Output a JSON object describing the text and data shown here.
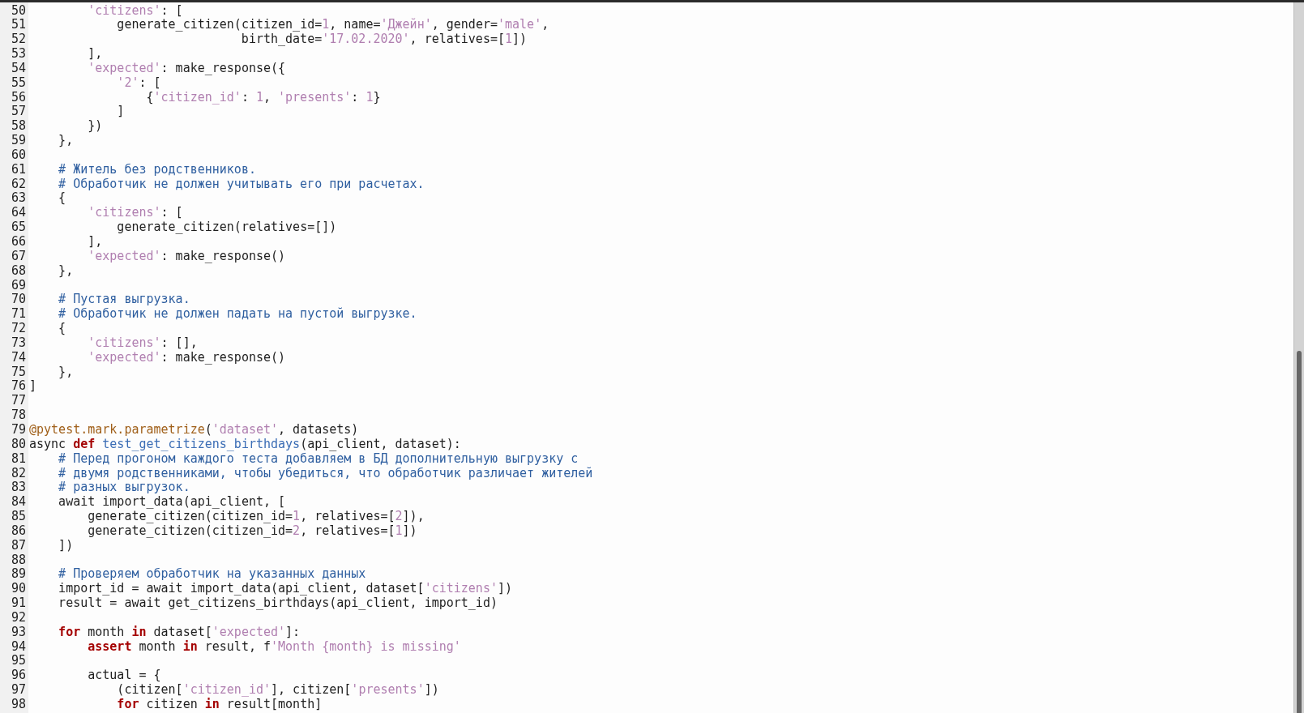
{
  "editor": {
    "lines": [
      {
        "number": "50",
        "tokens": [
          {
            "kind": "string",
            "text": "        'citizens'"
          },
          {
            "kind": "plain",
            "text": ": ["
          }
        ]
      },
      {
        "number": "51",
        "tokens": [
          {
            "kind": "plain",
            "text": "            generate_citizen(citizen_id="
          },
          {
            "kind": "number",
            "text": "1"
          },
          {
            "kind": "plain",
            "text": ", name="
          },
          {
            "kind": "string",
            "text": "'Джейн'"
          },
          {
            "kind": "plain",
            "text": ", gender="
          },
          {
            "kind": "string",
            "text": "'male'"
          },
          {
            "kind": "plain",
            "text": ","
          }
        ]
      },
      {
        "number": "52",
        "tokens": [
          {
            "kind": "plain",
            "text": "                             birth_date="
          },
          {
            "kind": "string",
            "text": "'17.02.2020'"
          },
          {
            "kind": "plain",
            "text": ", relatives=["
          },
          {
            "kind": "number",
            "text": "1"
          },
          {
            "kind": "plain",
            "text": "])"
          }
        ]
      },
      {
        "number": "53",
        "tokens": [
          {
            "kind": "plain",
            "text": "        ],"
          }
        ]
      },
      {
        "number": "54",
        "tokens": [
          {
            "kind": "string",
            "text": "        'expected'"
          },
          {
            "kind": "plain",
            "text": ": make_response({"
          }
        ]
      },
      {
        "number": "55",
        "tokens": [
          {
            "kind": "string",
            "text": "            '2'"
          },
          {
            "kind": "plain",
            "text": ": ["
          }
        ]
      },
      {
        "number": "56",
        "tokens": [
          {
            "kind": "plain",
            "text": "                {"
          },
          {
            "kind": "string",
            "text": "'citizen_id'"
          },
          {
            "kind": "plain",
            "text": ": "
          },
          {
            "kind": "number",
            "text": "1"
          },
          {
            "kind": "plain",
            "text": ", "
          },
          {
            "kind": "string",
            "text": "'presents'"
          },
          {
            "kind": "plain",
            "text": ": "
          },
          {
            "kind": "number",
            "text": "1"
          },
          {
            "kind": "plain",
            "text": "}"
          }
        ]
      },
      {
        "number": "57",
        "tokens": [
          {
            "kind": "plain",
            "text": "            ]"
          }
        ]
      },
      {
        "number": "58",
        "tokens": [
          {
            "kind": "plain",
            "text": "        })"
          }
        ]
      },
      {
        "number": "59",
        "tokens": [
          {
            "kind": "plain",
            "text": "    },"
          }
        ]
      },
      {
        "number": "60"
      },
      {
        "number": "61",
        "tokens": [
          {
            "kind": "comment",
            "text": "    # Житель без родственников."
          }
        ]
      },
      {
        "number": "62",
        "tokens": [
          {
            "kind": "comment",
            "text": "    # Обработчик не должен учитывать его при расчетах."
          }
        ]
      },
      {
        "number": "63",
        "tokens": [
          {
            "kind": "plain",
            "text": "    {"
          }
        ]
      },
      {
        "number": "64",
        "tokens": [
          {
            "kind": "string",
            "text": "        'citizens'"
          },
          {
            "kind": "plain",
            "text": ": ["
          }
        ]
      },
      {
        "number": "65",
        "tokens": [
          {
            "kind": "plain",
            "text": "            generate_citizen(relatives=[])"
          }
        ]
      },
      {
        "number": "66",
        "tokens": [
          {
            "kind": "plain",
            "text": "        ],"
          }
        ]
      },
      {
        "number": "67",
        "tokens": [
          {
            "kind": "string",
            "text": "        'expected'"
          },
          {
            "kind": "plain",
            "text": ": make_response()"
          }
        ]
      },
      {
        "number": "68",
        "tokens": [
          {
            "kind": "plain",
            "text": "    },"
          }
        ]
      },
      {
        "number": "69"
      },
      {
        "number": "70",
        "tokens": [
          {
            "kind": "comment",
            "text": "    # Пустая выгрузка."
          }
        ]
      },
      {
        "number": "71",
        "tokens": [
          {
            "kind": "comment",
            "text": "    # Обработчик не должен падать на пустой выгрузке."
          }
        ]
      },
      {
        "number": "72",
        "tokens": [
          {
            "kind": "plain",
            "text": "    {"
          }
        ]
      },
      {
        "number": "73",
        "tokens": [
          {
            "kind": "string",
            "text": "        'citizens'"
          },
          {
            "kind": "plain",
            "text": ": [],"
          }
        ]
      },
      {
        "number": "74",
        "tokens": [
          {
            "kind": "string",
            "text": "        'expected'"
          },
          {
            "kind": "plain",
            "text": ": make_response()"
          }
        ]
      },
      {
        "number": "75",
        "tokens": [
          {
            "kind": "plain",
            "text": "    },"
          }
        ]
      },
      {
        "number": "76",
        "tokens": [
          {
            "kind": "plain",
            "text": "]"
          }
        ]
      },
      {
        "number": "77"
      },
      {
        "number": "78"
      },
      {
        "number": "79",
        "tokens": [
          {
            "kind": "decorator",
            "text": "@pytest.mark.parametrize"
          },
          {
            "kind": "plain",
            "text": "("
          },
          {
            "kind": "string",
            "text": "'dataset'"
          },
          {
            "kind": "plain",
            "text": ", datasets)"
          }
        ]
      },
      {
        "number": "80",
        "tokens": [
          {
            "kind": "plain",
            "text": "async "
          },
          {
            "kind": "keyword",
            "text": "def"
          },
          {
            "kind": "function",
            "text": " test_get_citizens_birthdays"
          },
          {
            "kind": "plain",
            "text": "(api_client, dataset):"
          }
        ]
      },
      {
        "number": "81",
        "tokens": [
          {
            "kind": "comment",
            "text": "    # Перед прогоном каждого теста добавляем в БД дополнительную выгрузку с"
          }
        ]
      },
      {
        "number": "82",
        "tokens": [
          {
            "kind": "comment",
            "text": "    # двумя родственниками, чтобы убедиться, что обработчик различает жителей"
          }
        ]
      },
      {
        "number": "83",
        "tokens": [
          {
            "kind": "comment",
            "text": "    # разных выгрузок."
          }
        ]
      },
      {
        "number": "84",
        "tokens": [
          {
            "kind": "plain",
            "text": "    await import_data(api_client, ["
          }
        ]
      },
      {
        "number": "85",
        "tokens": [
          {
            "kind": "plain",
            "text": "        generate_citizen(citizen_id="
          },
          {
            "kind": "number",
            "text": "1"
          },
          {
            "kind": "plain",
            "text": ", relatives=["
          },
          {
            "kind": "number",
            "text": "2"
          },
          {
            "kind": "plain",
            "text": "]),"
          }
        ]
      },
      {
        "number": "86",
        "tokens": [
          {
            "kind": "plain",
            "text": "        generate_citizen(citizen_id="
          },
          {
            "kind": "number",
            "text": "2"
          },
          {
            "kind": "plain",
            "text": ", relatives=["
          },
          {
            "kind": "number",
            "text": "1"
          },
          {
            "kind": "plain",
            "text": "])"
          }
        ]
      },
      {
        "number": "87",
        "tokens": [
          {
            "kind": "plain",
            "text": "    ])"
          }
        ]
      },
      {
        "number": "88"
      },
      {
        "number": "89",
        "tokens": [
          {
            "kind": "comment",
            "text": "    # Проверяем обработчик на указанных данных"
          }
        ]
      },
      {
        "number": "90",
        "tokens": [
          {
            "kind": "plain",
            "text": "    import_id = await import_data(api_client, dataset["
          },
          {
            "kind": "string",
            "text": "'citizens'"
          },
          {
            "kind": "plain",
            "text": "])"
          }
        ]
      },
      {
        "number": "91",
        "tokens": [
          {
            "kind": "plain",
            "text": "    result = await get_citizens_birthdays(api_client, import_id)"
          }
        ]
      },
      {
        "number": "92"
      },
      {
        "number": "93",
        "tokens": [
          {
            "kind": "keyword",
            "text": "    for"
          },
          {
            "kind": "plain",
            "text": " month "
          },
          {
            "kind": "keyword",
            "text": "in"
          },
          {
            "kind": "plain",
            "text": " dataset["
          },
          {
            "kind": "string",
            "text": "'expected'"
          },
          {
            "kind": "plain",
            "text": "]:"
          }
        ]
      },
      {
        "number": "94",
        "tokens": [
          {
            "kind": "keyword",
            "text": "        assert"
          },
          {
            "kind": "plain",
            "text": " month "
          },
          {
            "kind": "keyword",
            "text": "in"
          },
          {
            "kind": "plain",
            "text": " result, f"
          },
          {
            "kind": "string",
            "text": "'Month {month} is missing'"
          }
        ]
      },
      {
        "number": "95"
      },
      {
        "number": "96",
        "tokens": [
          {
            "kind": "plain",
            "text": "        actual = {"
          }
        ]
      },
      {
        "number": "97",
        "tokens": [
          {
            "kind": "plain",
            "text": "            (citizen["
          },
          {
            "kind": "string",
            "text": "'citizen_id'"
          },
          {
            "kind": "plain",
            "text": "], citizen["
          },
          {
            "kind": "string",
            "text": "'presents'"
          },
          {
            "kind": "plain",
            "text": "])"
          }
        ]
      },
      {
        "number": "98",
        "tokens": [
          {
            "kind": "keyword",
            "text": "            for"
          },
          {
            "kind": "plain",
            "text": " citizen "
          },
          {
            "kind": "keyword",
            "text": "in"
          },
          {
            "kind": "plain",
            "text": " result[month]"
          }
        ]
      }
    ]
  }
}
